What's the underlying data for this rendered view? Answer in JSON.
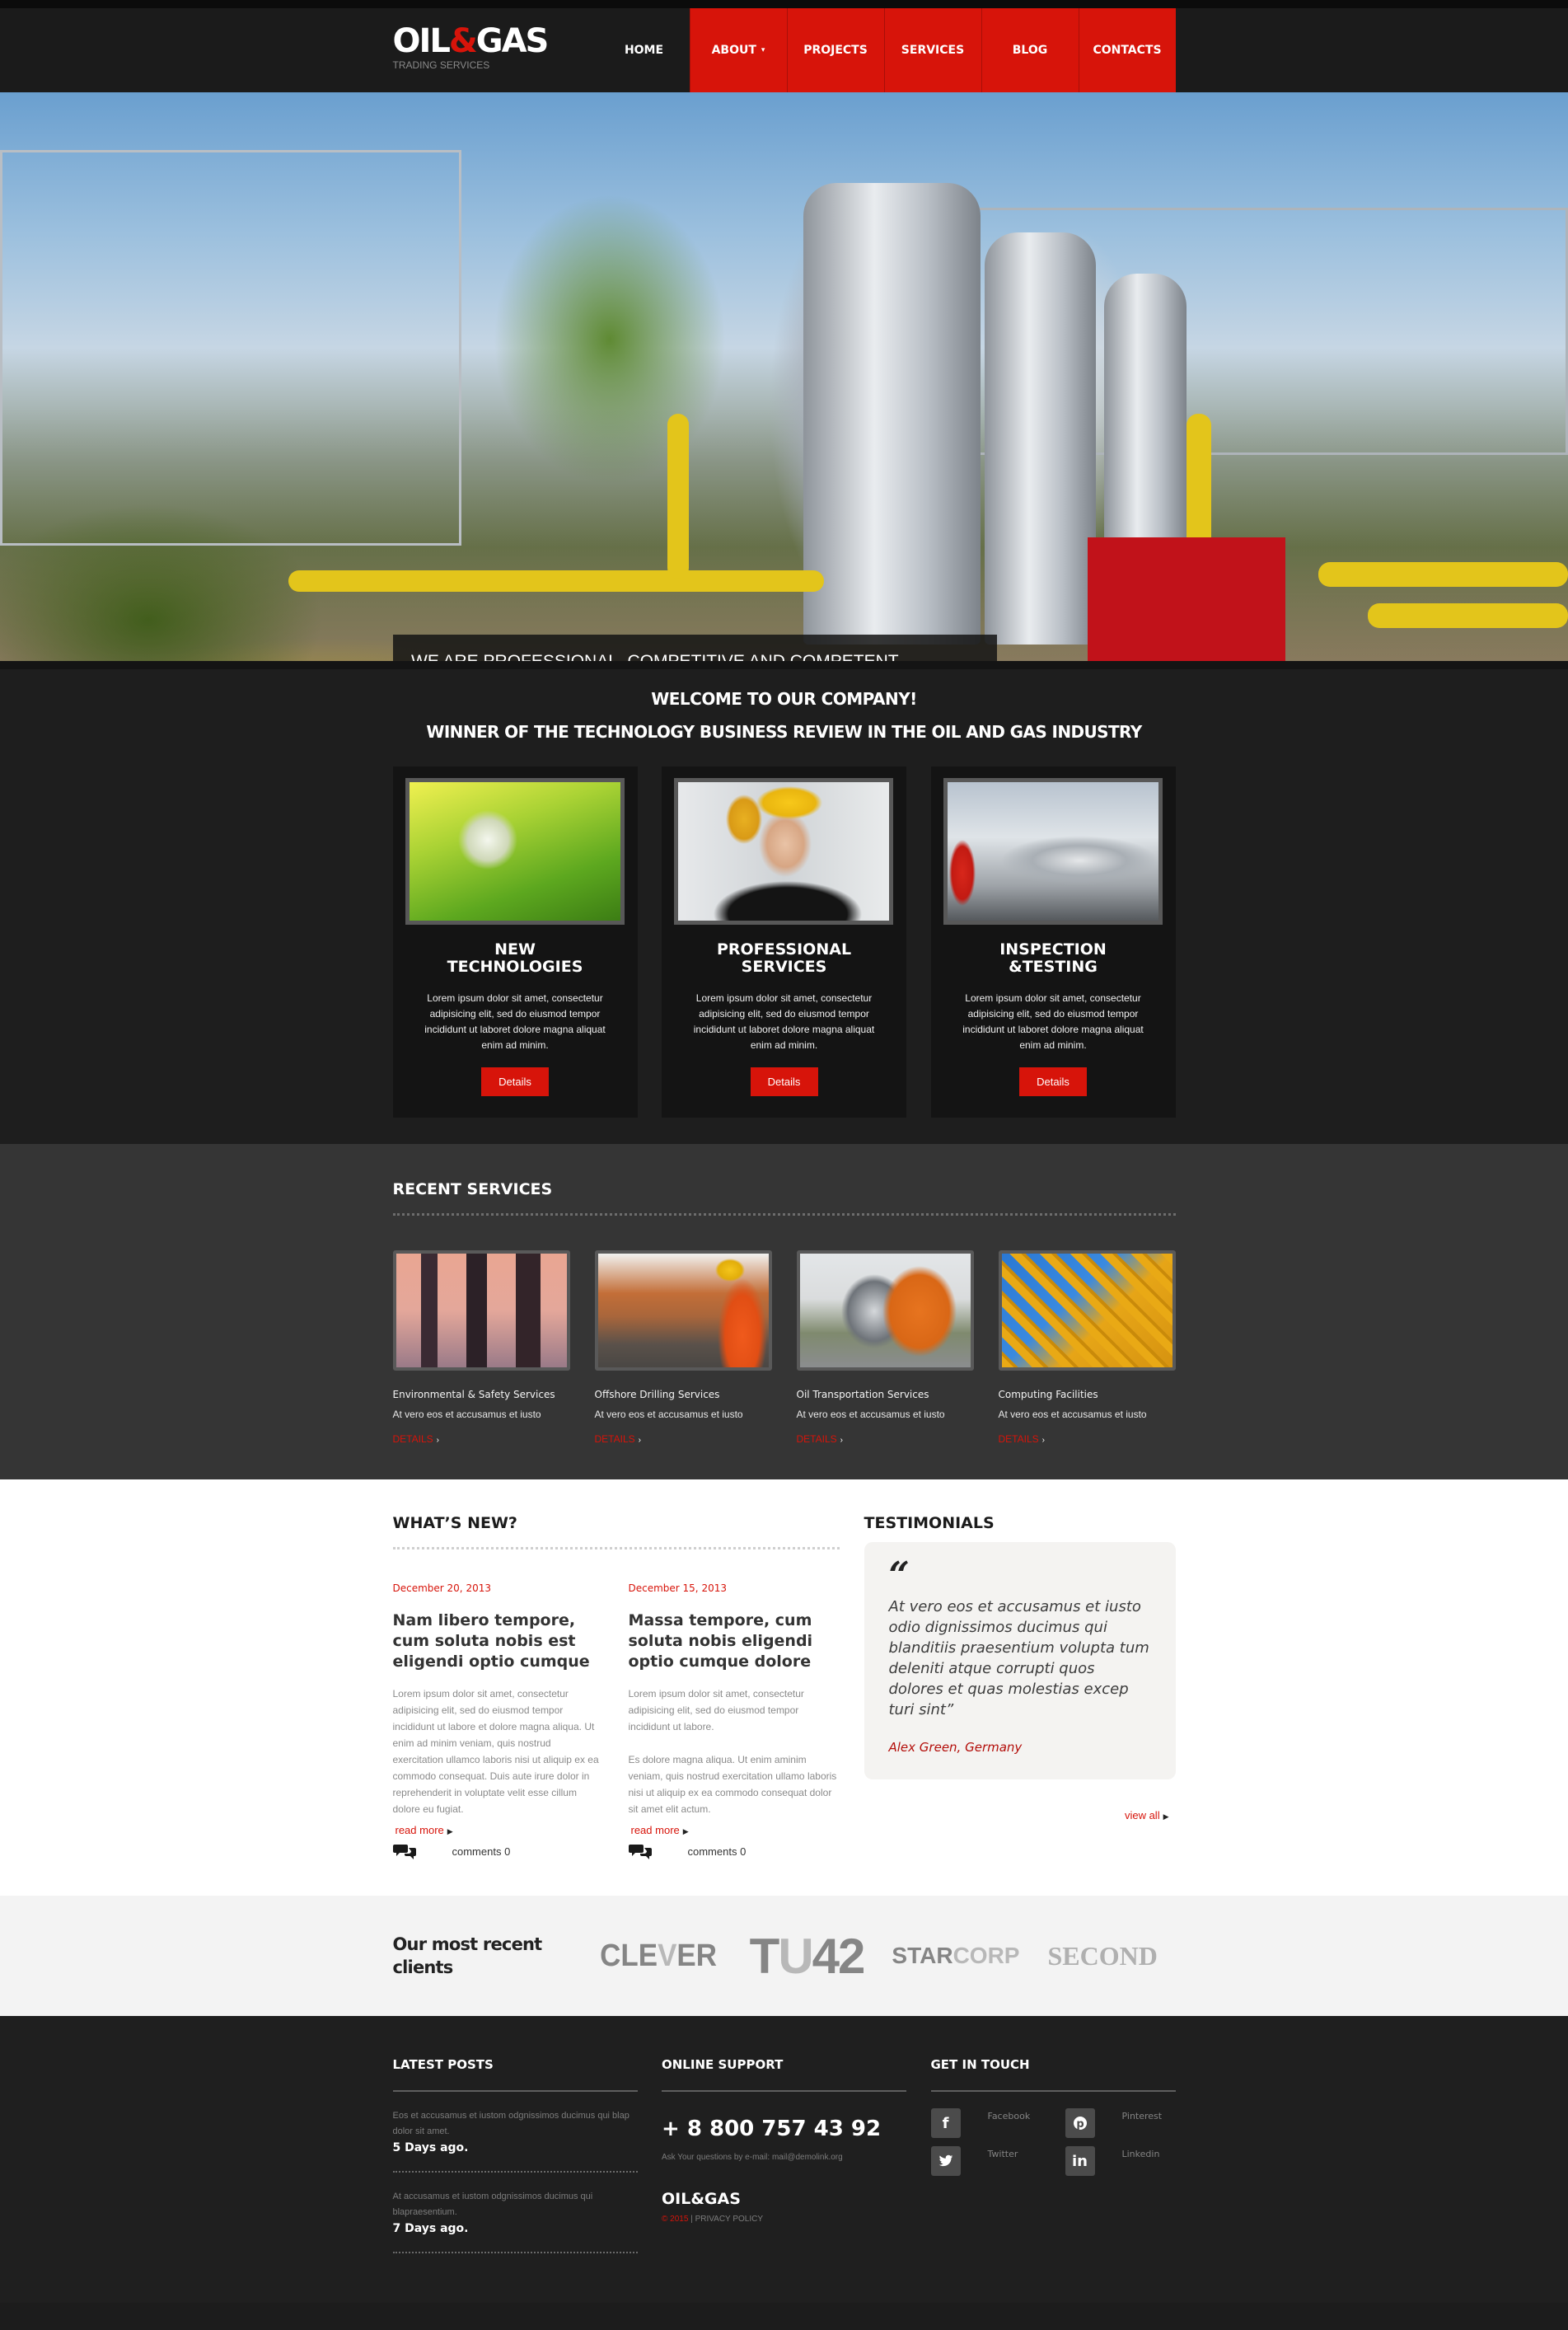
{
  "header": {
    "logo_main_1": "OIL",
    "logo_amp": "&",
    "logo_main_2": "GAS",
    "logo_sub": "TRADING SERVICES",
    "nav": [
      {
        "label": "HOME"
      },
      {
        "label": "ABOUT",
        "has_dropdown": true
      },
      {
        "label": "PROJECTS"
      },
      {
        "label": "SERVICES"
      },
      {
        "label": "BLOG"
      },
      {
        "label": "CONTACTS"
      }
    ],
    "caret": "▾"
  },
  "hero": {
    "caption": "We are professional, competitive and competent in our service",
    "slides": 3,
    "active_slide": 1
  },
  "welcome": {
    "title": "WELCOME TO OUR COMPANY!",
    "subtitle": "WINNER OF THE TECHNOLOGY BUSINESS REVIEW IN THE OIL AND GAS INDUSTRY",
    "features": [
      {
        "title_1": "NEW",
        "title_2": "TECHNOLOGIES",
        "image": "globe-in-grass",
        "text": "Lorem ipsum dolor sit amet, consectetur adipisicing elit, sed do eiusmod tempor incididunt ut laboret dolore magna aliquat enim ad minim.",
        "button": "Details"
      },
      {
        "title_1": "PROFESSIONAL",
        "title_2": "SERVICES",
        "image": "worker-hard-hat",
        "text": "Lorem ipsum dolor sit amet, consectetur adipisicing elit, sed do eiusmod tempor incididunt ut laboret dolore magna aliquat enim ad minim.",
        "button": "Details"
      },
      {
        "title_1": "INSPECTION",
        "title_2": "&TESTING",
        "image": "tanker-truck",
        "text": "Lorem ipsum dolor sit amet, consectetur adipisicing elit, sed do eiusmod tempor incididunt ut laboret dolore magna aliquat enim ad minim.",
        "button": "Details"
      }
    ]
  },
  "recent_services": {
    "title": "RECENT SERVICES",
    "items": [
      {
        "title": "Environmental & Safety Services",
        "text": "At vero eos et accusamus et iusto",
        "link": "DETAILS",
        "image": "refinery-towers"
      },
      {
        "title": "Offshore Drilling Services",
        "text": "At vero eos et accusamus et iusto",
        "link": "DETAILS",
        "image": "engineer-orange-vest"
      },
      {
        "title": "Oil Transportation Services",
        "text": "At vero eos et accusamus et iusto",
        "link": "DETAILS",
        "image": "orange-tanker"
      },
      {
        "title": "Computing Facilities",
        "text": "At vero eos et accusamus et iusto",
        "link": "DETAILS",
        "image": "yellow-crane"
      }
    ],
    "arrow": "›"
  },
  "whats_new": {
    "title": "WHAT’S NEW?",
    "posts": [
      {
        "date": "December 20, 2013",
        "title": "Nam libero tempore, cum soluta nobis est eligendi optio cumque",
        "paragraphs": [
          "Lorem ipsum dolor sit amet, consectetur adipisicing elit, sed do eiusmod tempor incididunt ut labore et dolore magna aliqua. Ut enim ad minim veniam, quis nostrud exercitation ullamco laboris nisi ut aliquip ex ea commodo consequat. Duis aute irure dolor in reprehenderit in voluptate velit esse cillum dolore eu fugiat."
        ],
        "read_more": "read more",
        "comments": "comments 0"
      },
      {
        "date": "December 15, 2013",
        "title": "Massa tempore, cum soluta nobis eligendi optio cumque dolore",
        "paragraphs": [
          "Lorem ipsum dolor sit amet, consectetur adipisicing elit, sed do eiusmod tempor incididunt ut labore.",
          "Es dolore magna aliqua. Ut enim aminim veniam, quis nostrud exercitation ullamo laboris nisi ut aliquip ex ea commodo consequat dolor sit amet elit actum."
        ],
        "read_more": "read more",
        "comments": "comments 0"
      }
    ]
  },
  "testimonials": {
    "title": "TESTIMONIALS",
    "quote_mark": "“",
    "text": "At vero eos et accusamus et iusto odio dignissimos ducimus qui blanditiis praesentium volupta tum deleniti atque corrupti quos dolores et quas molestias excep turi sint”",
    "author": "Alex Green, Germany",
    "view_all": "view all"
  },
  "clients": {
    "title": "Our most recent clients",
    "logos": {
      "clever_a": "CLE",
      "clever_b": "V",
      "clever_c": "ER",
      "tu_a": "T",
      "tu_b": "U",
      "tu_c": "42",
      "star_a": "STAR",
      "star_b": "CORP",
      "second": "SECOND"
    }
  },
  "footer": {
    "latest_posts": {
      "title": "LATEST POSTS",
      "items": [
        {
          "text": "Eos et accusamus et iustom odgnissimos ducimus qui blap dolor sit amet.",
          "time": "5 Days ago."
        },
        {
          "text": "At accusamus et iustom odgnissimos ducimus qui blapraesentium.",
          "time": "7 Days ago."
        }
      ]
    },
    "online_support": {
      "title": "ONLINE SUPPORT",
      "phone": "+ 8 800 757 43 92",
      "ask": "Ask Your questions by e-mail: mail@demolink.org",
      "logo": "OIL&GAS",
      "copyright": "© 2015",
      "separator": " | ",
      "privacy": "PRIVACY POLICY"
    },
    "get_in_touch": {
      "title": "GET IN TOUCH",
      "social": [
        {
          "label": "Facebook",
          "glyph": "f"
        },
        {
          "label": "Pinterest",
          "glyph": "℗"
        },
        {
          "label": "Twitter",
          "glyph": "🐦"
        },
        {
          "label": "Linkedin",
          "glyph": "in"
        }
      ]
    }
  },
  "colors": {
    "accent_red": "#d7140a",
    "dark_bg": "#1e1e1e",
    "services_bg": "#353535",
    "clients_bg": "#f3f3f3"
  }
}
